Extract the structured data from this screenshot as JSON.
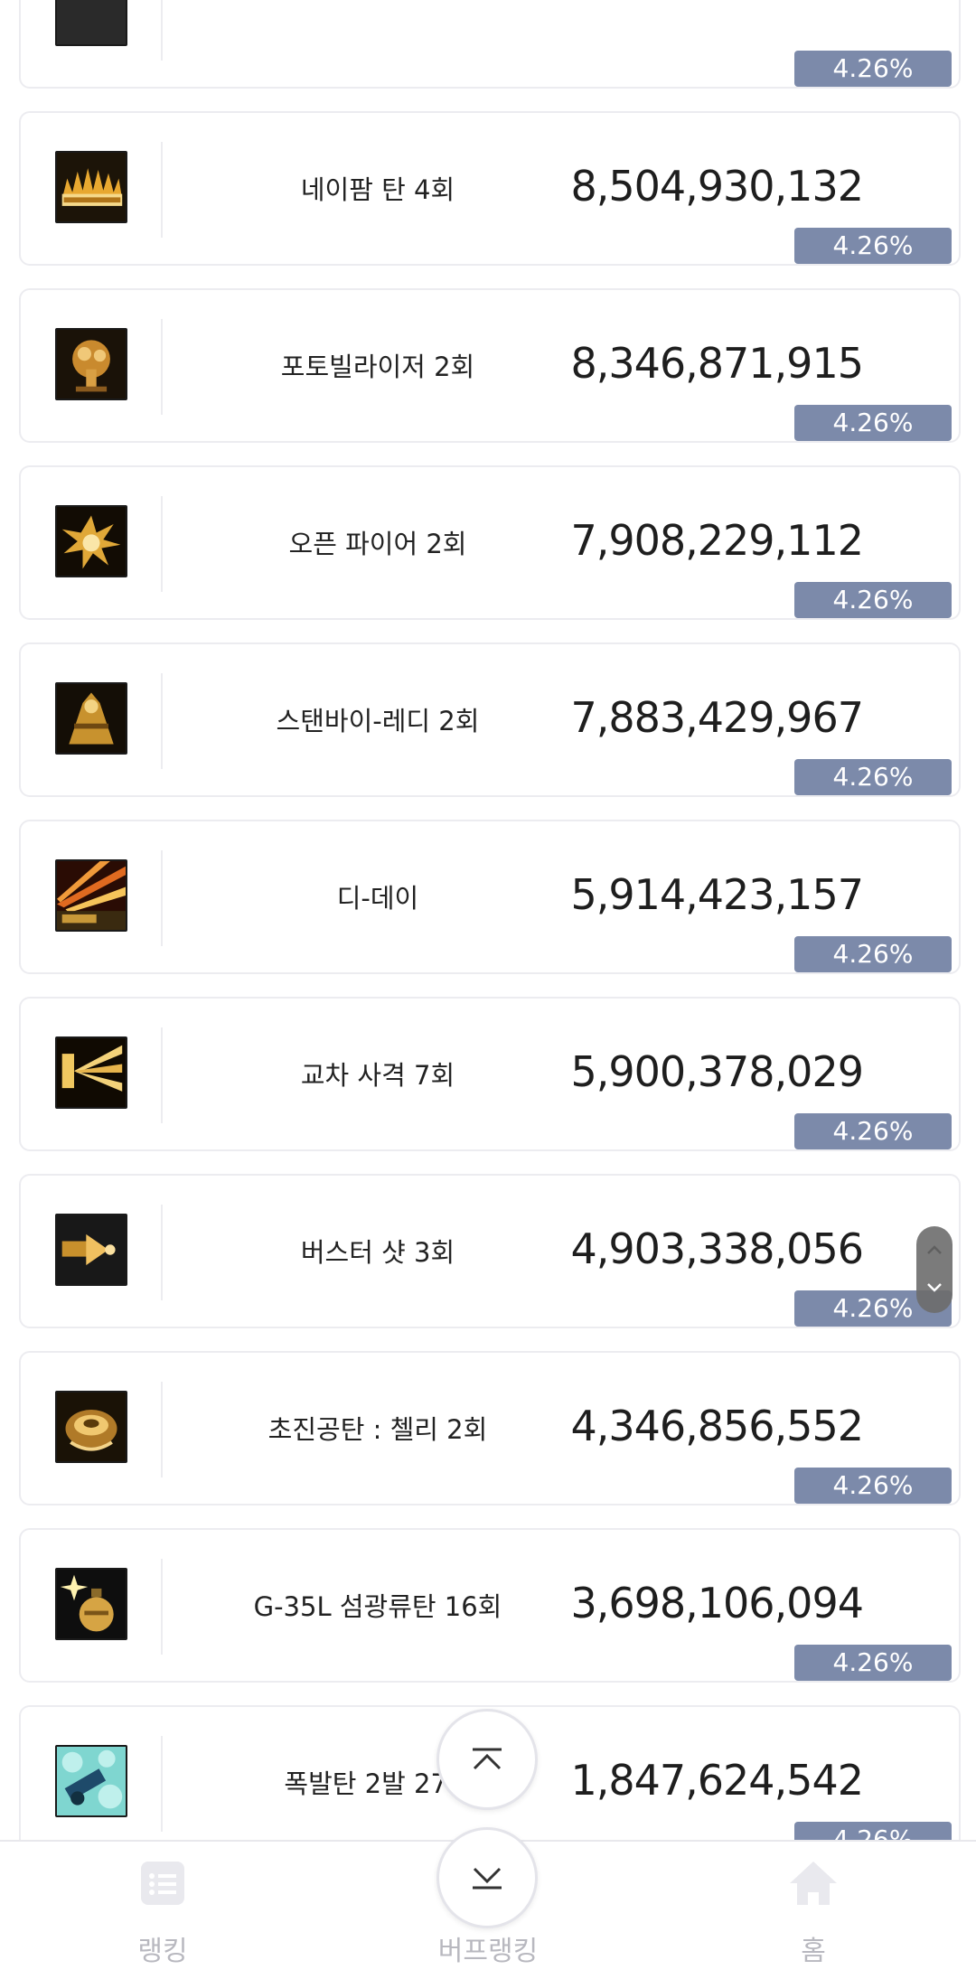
{
  "rows": [
    {
      "name": "",
      "damage": "",
      "percent": "4.26%",
      "icon": "cropped-skill-icon"
    },
    {
      "name": "네이팜 탄 4회",
      "damage": "8,504,930,132",
      "percent": "4.26%",
      "icon": "napalm-fire-icon"
    },
    {
      "name": "포토빌라이저 2회",
      "damage": "8,346,871,915",
      "percent": "4.26%",
      "icon": "photovilizer-explosion-icon"
    },
    {
      "name": "오픈 파이어 2회",
      "damage": "7,908,229,112",
      "percent": "4.26%",
      "icon": "open-fire-icon"
    },
    {
      "name": "스탠바이-레디 2회",
      "damage": "7,883,429,967",
      "percent": "4.26%",
      "icon": "standby-ready-icon"
    },
    {
      "name": "디-데이",
      "damage": "5,914,423,157",
      "percent": "4.26%",
      "icon": "d-day-icon"
    },
    {
      "name": "교차 사격 7회",
      "damage": "5,900,378,029",
      "percent": "4.26%",
      "icon": "cross-fire-icon"
    },
    {
      "name": "버스터 샷 3회",
      "damage": "4,903,338,056",
      "percent": "4.26%",
      "icon": "buster-shot-icon"
    },
    {
      "name": "초진공탄 : 첼리 2회",
      "damage": "4,346,856,552",
      "percent": "4.26%",
      "icon": "vacuum-bomb-icon"
    },
    {
      "name": "G-35L 섬광류탄 16회",
      "damage": "3,698,106,094",
      "percent": "4.26%",
      "icon": "flash-grenade-icon"
    },
    {
      "name": "폭발탄 2발 27회",
      "damage": "1,847,624,542",
      "percent": "4.26%",
      "icon": "explosive-round-icon"
    }
  ],
  "nav": {
    "ranking_label": "랭킹",
    "buff_ranking_label": "버프랭킹",
    "home_label": "홈"
  },
  "colors": {
    "percent_badge": "#7c8aaa",
    "card_border": "#ececf0",
    "nav_label": "#b8b8bf"
  }
}
